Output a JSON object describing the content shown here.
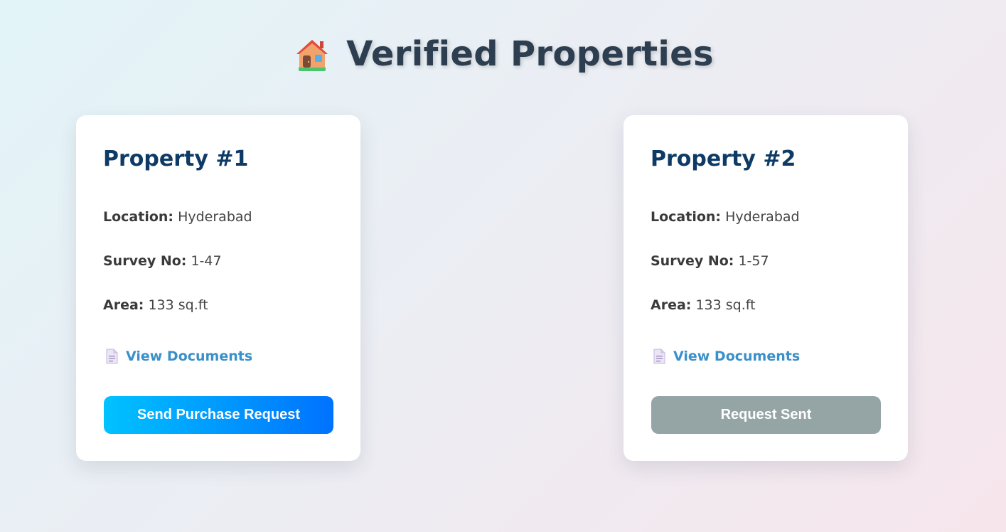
{
  "header": {
    "title": "Verified Properties",
    "icon": "house-icon"
  },
  "properties": [
    {
      "title": "Property #1",
      "location_label": "Location:",
      "location": "Hyderabad",
      "survey_label": "Survey No:",
      "survey_no": "1-47",
      "area_label": "Area:",
      "area": "133 sq.ft",
      "documents_link": "View Documents",
      "documents_icon": "document-icon",
      "button_label": "Send Purchase Request",
      "button_state": "active"
    },
    {
      "title": "Property #2",
      "location_label": "Location:",
      "location": "Hyderabad",
      "survey_label": "Survey No:",
      "survey_no": "1-57",
      "area_label": "Area:",
      "area": "133 sq.ft",
      "documents_link": "View Documents",
      "documents_icon": "document-icon",
      "button_label": "Request Sent",
      "button_state": "disabled"
    }
  ],
  "colors": {
    "title_text": "#2c3e50",
    "card_title": "#0e3a66",
    "link": "#3a90c8",
    "button_gradient_start": "#00c2ff",
    "button_gradient_end": "#0072ff",
    "button_disabled": "#95a5a6"
  }
}
